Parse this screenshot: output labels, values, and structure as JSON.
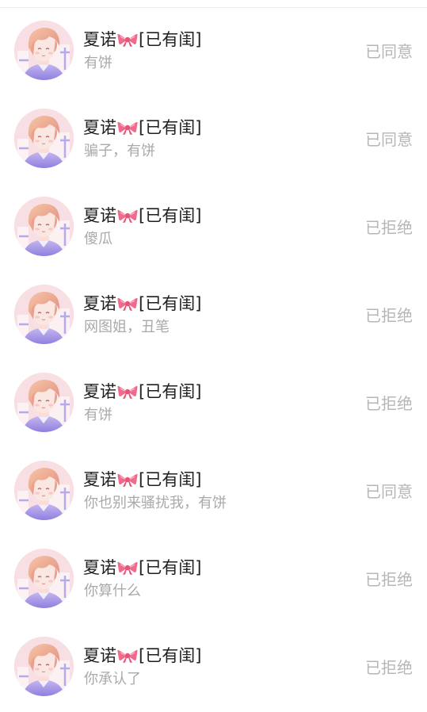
{
  "requests": [
    {
      "name_prefix": "夏诺",
      "bow": "bow-icon",
      "name_suffix": "[已有闺]",
      "message": "有饼",
      "status": "已同意"
    },
    {
      "name_prefix": "夏诺",
      "bow": "bow-icon",
      "name_suffix": "[已有闺]",
      "message": "骗子，有饼",
      "status": "已同意"
    },
    {
      "name_prefix": "夏诺",
      "bow": "bow-icon",
      "name_suffix": "[已有闺]",
      "message": "傻瓜",
      "status": "已拒绝"
    },
    {
      "name_prefix": "夏诺",
      "bow": "bow-icon",
      "name_suffix": "[已有闺]",
      "message": "网图姐，丑笔",
      "status": "已拒绝"
    },
    {
      "name_prefix": "夏诺",
      "bow": "bow-icon",
      "name_suffix": "[已有闺]",
      "message": "有饼",
      "status": "已拒绝"
    },
    {
      "name_prefix": "夏诺",
      "bow": "bow-icon",
      "name_suffix": "[已有闺]",
      "message": "你也别来骚扰我，有饼",
      "status": "已同意"
    },
    {
      "name_prefix": "夏诺",
      "bow": "bow-icon",
      "name_suffix": "[已有闺]",
      "message": "你算什么",
      "status": "已拒绝"
    },
    {
      "name_prefix": "夏诺",
      "bow": "bow-icon",
      "name_suffix": "[已有闺]",
      "message": "你承认了",
      "status": "已拒绝"
    }
  ],
  "colors": {
    "name": "#1f1f1f",
    "message": "#a9a9a9",
    "status": "#b6b6b6",
    "bow": "#f06b8b"
  }
}
